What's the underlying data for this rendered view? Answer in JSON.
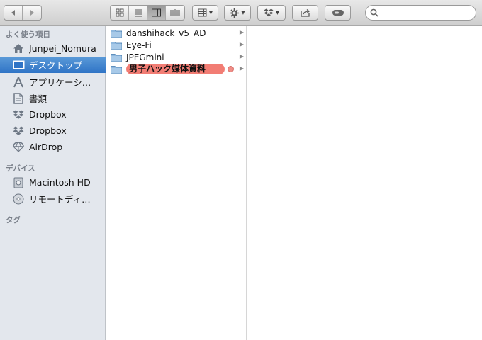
{
  "toolbar": {
    "back_icon": "back-arrow-icon",
    "forward_icon": "forward-arrow-icon",
    "view_modes": [
      "icon-view-icon",
      "list-view-icon",
      "column-view-icon",
      "coverflow-view-icon"
    ],
    "active_view": "column-view-icon",
    "arrange_icon": "arrange-grid-icon",
    "action_icon": "gear-icon",
    "dropbox_icon": "dropbox-icon",
    "share_icon": "share-icon",
    "tags_icon": "tag-toggle-icon",
    "search": {
      "placeholder": "",
      "value": ""
    }
  },
  "sidebar": {
    "favorites_header": "よく使う項目",
    "favorites": [
      {
        "label": "Junpei_Nomura",
        "icon": "home-icon"
      },
      {
        "label": "デスクトップ",
        "icon": "desktop-icon",
        "selected": true
      },
      {
        "label": "アプリケーシ…",
        "icon": "applications-icon"
      },
      {
        "label": "書類",
        "icon": "documents-icon"
      },
      {
        "label": "Dropbox",
        "icon": "dropbox-icon"
      },
      {
        "label": "Dropbox",
        "icon": "dropbox-icon"
      },
      {
        "label": "AirDrop",
        "icon": "airdrop-icon"
      }
    ],
    "devices_header": "デバイス",
    "devices": [
      {
        "label": "Macintosh HD",
        "icon": "hard-drive-icon"
      },
      {
        "label": "リモートディ…",
        "icon": "remote-disc-icon"
      }
    ],
    "tags_header": "タグ"
  },
  "column1": {
    "items": [
      {
        "name": "danshihack_v5_AD",
        "icon": "folder-icon"
      },
      {
        "name": "Eye-Fi",
        "icon": "folder-icon"
      },
      {
        "name": "JPEGmini",
        "icon": "folder-icon"
      },
      {
        "name": "男子ハック媒体資料",
        "icon": "folder-icon",
        "tag_color": "#f27d74"
      }
    ]
  }
}
